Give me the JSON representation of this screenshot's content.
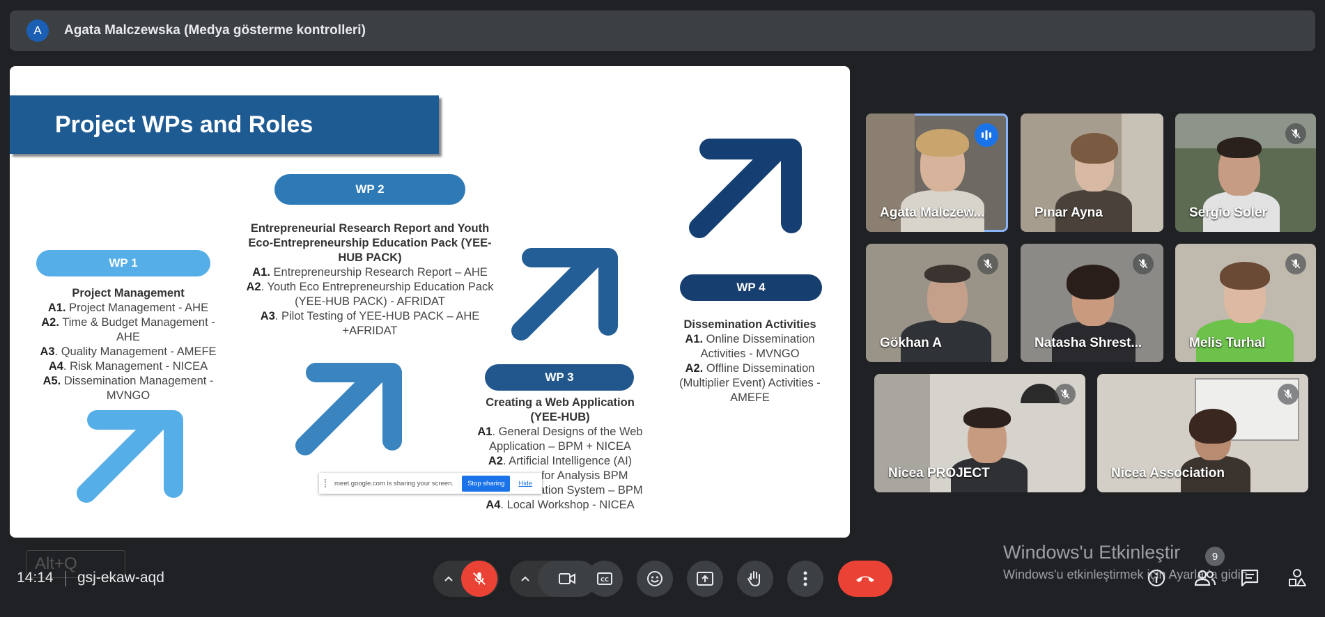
{
  "presenter": {
    "avatar_letter": "A",
    "label": "Agata Malczewska (Medya gösterme kontrolleri)"
  },
  "slide": {
    "title": "Project WPs and Roles",
    "wp1": {
      "label": "WP 1",
      "heading": "Project Management",
      "items": [
        {
          "code": "A1.",
          "text": " Project Management - AHE"
        },
        {
          "code": "A2.",
          "text": " Time & Budget Management - AHE"
        },
        {
          "code": "A3",
          "text": ". Quality Management - AMEFE"
        },
        {
          "code": "A4",
          "text": ". Risk Management - NICEA"
        },
        {
          "code": "A5.",
          "text": " Dissemination Management - MVNGO"
        }
      ]
    },
    "wp2": {
      "label": "WP 2",
      "heading": "Entrepreneurial Research Report and Youth Eco-Entrepreneurship Education Pack (YEE-HUB PACK)",
      "items": [
        {
          "code": "A1.",
          "text": " Entrepreneurship Research Report – AHE"
        },
        {
          "code": "A2",
          "text": ". Youth Eco Entrepreneurship Education Pack (YEE-HUB PACK) -  AFRIDAT"
        },
        {
          "code": "A3",
          "text": ". Pilot Testing of YEE-HUB PACK – AHE +AFRIDAT"
        }
      ]
    },
    "wp3": {
      "label": "WP 3",
      "heading": "Creating a Web Application (YEE-HUB)",
      "items": [
        {
          "code": "A1",
          "text": ". General Designs of the Web Application – BPM + NICEA"
        },
        {
          "code": "A2",
          "text": ". Artificial Intelligence (AI)"
        },
        {
          "code": "",
          "text": "s for Analysis BPM"
        },
        {
          "code": "",
          "text": "nation System – BPM"
        },
        {
          "code": "A4",
          "text": ". Local Workshop - NICEA"
        }
      ]
    },
    "wp4": {
      "label": "WP 4",
      "heading": "Dissemination Activities",
      "items": [
        {
          "code": "A1.",
          "text": " Online Dissemination Activities - MVNGO"
        },
        {
          "code": "A2.",
          "text": " Offline Dissemination (Multiplier Event) Activities - AMEFE"
        }
      ]
    },
    "colors": {
      "wp1": "#56aee8",
      "wp2": "#2e7ab7",
      "wp3": "#21578c",
      "wp4": "#163e6e",
      "banner": "#1f5b93"
    }
  },
  "share_popup": {
    "message": "meet.google.com is sharing your screen.",
    "stop_label": "Stop sharing",
    "hide_label": "Hide"
  },
  "participants": [
    {
      "name": "Agata Malczew...",
      "state": "speaking"
    },
    {
      "name": "Pınar Ayna",
      "state": "on"
    },
    {
      "name": "Sergio Soler",
      "state": "muted"
    },
    {
      "name": "Gökhan A",
      "state": "muted"
    },
    {
      "name": "Natasha Shrest...",
      "state": "muted"
    },
    {
      "name": "Melis Turhal",
      "state": "muted"
    },
    {
      "name": "Nicea PROJECT",
      "state": "muted"
    },
    {
      "name": "Nicea Association",
      "state": "muted"
    }
  ],
  "bottom_bar": {
    "time": "14:14",
    "meeting_code": "gsj-ekaw-aqd",
    "shortcut_hint": "Alt+Q",
    "participant_count": "9"
  },
  "windows_activation": {
    "title": "Windows'u Etkinleştir",
    "subtitle": "Windows'u etkinleştirmek için Ayarlar'a gidin."
  },
  "icons": {
    "mic_off": "mic-off-icon",
    "camera": "camera-icon",
    "captions": "closed-captions-icon",
    "emoji": "emoji-icon",
    "present": "present-screen-icon",
    "raise_hand": "raise-hand-icon",
    "more": "more-options-icon",
    "end_call": "end-call-icon",
    "info": "info-icon",
    "people": "people-icon",
    "chat": "chat-icon",
    "activities": "activities-icon"
  }
}
